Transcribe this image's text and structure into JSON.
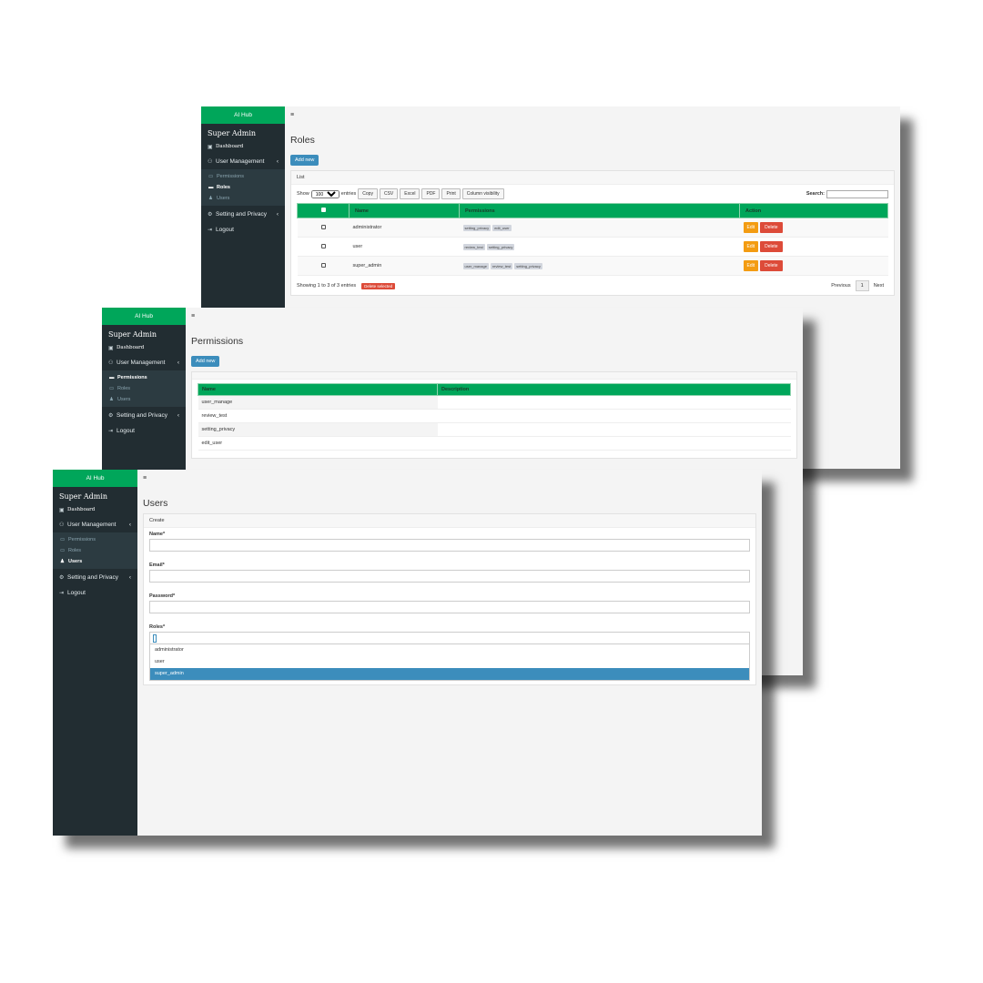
{
  "app": {
    "brand": "AI Hub",
    "user_name": "Super Admin"
  },
  "sidebar": {
    "dashboard": "Dashboard",
    "user_management": "User Management",
    "permissions": "Permissions",
    "roles": "Roles",
    "users": "Users",
    "settings": "Setting and Privacy",
    "logout": "Logout"
  },
  "topbar": {
    "menu_icon": "≡"
  },
  "roles_page": {
    "title": "Roles",
    "add_new": "Add new",
    "box_title": "List",
    "show_label": "Show",
    "entries_value": "100",
    "entries_label": "entries",
    "buttons": [
      "Copy",
      "CSV",
      "Excel",
      "PDF",
      "Print",
      "Column visibility"
    ],
    "search_label": "Search:",
    "columns": [
      "Name",
      "Permissions",
      "Action"
    ],
    "rows": [
      {
        "name": "administrator",
        "permissions": [
          "setting_privacy",
          "edit_user"
        ]
      },
      {
        "name": "user",
        "permissions": [
          "review_test",
          "setting_privacy"
        ]
      },
      {
        "name": "super_admin",
        "permissions": [
          "user_manage",
          "review_test",
          "setting_privacy"
        ]
      }
    ],
    "edit_label": "Edit",
    "delete_label": "Delete",
    "showing": "Showing 1 to 3 of 3 entries",
    "delete_selected": "Delete selected",
    "previous": "Previous",
    "page": "1",
    "next": "Next"
  },
  "permissions_page": {
    "title": "Permissions",
    "add_new": "Add new",
    "columns": [
      "Name",
      "Description"
    ],
    "rows": [
      "user_manage",
      "review_test",
      "setting_privacy",
      "edit_user"
    ]
  },
  "users_page": {
    "title": "Users",
    "box_title": "Create",
    "name_label": "Name*",
    "email_label": "Email*",
    "password_label": "Password*",
    "roles_label": "Roles*",
    "role_options": [
      "administrator",
      "user",
      "super_admin"
    ],
    "selected_option": "super_admin"
  }
}
